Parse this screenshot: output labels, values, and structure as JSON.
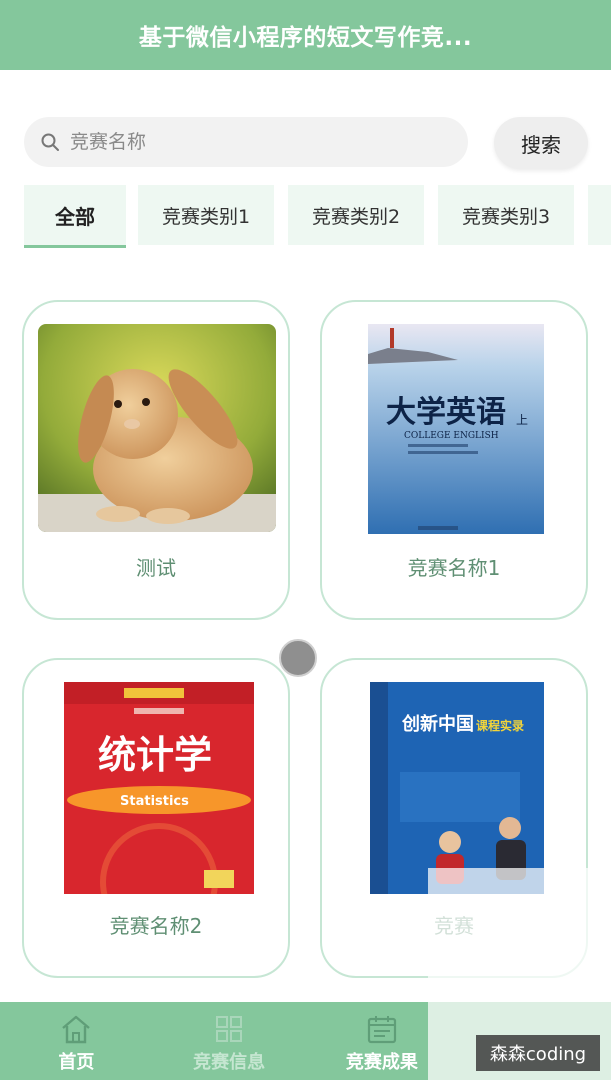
{
  "header": {
    "title": "基于微信小程序的短文写作竞..."
  },
  "search": {
    "placeholder": "竞赛名称",
    "button_label": "搜索"
  },
  "tabs": [
    {
      "label": "全部",
      "active": true
    },
    {
      "label": "竞赛类别1",
      "active": false
    },
    {
      "label": "竞赛类别2",
      "active": false
    },
    {
      "label": "竞赛类别3",
      "active": false
    }
  ],
  "cards": [
    {
      "name": "测试",
      "image": "rabbit-photo"
    },
    {
      "name": "竞赛名称1",
      "image": "book-cover-college-english",
      "cover_title": "大学英语",
      "cover_mark": "上",
      "cover_subtitle": "COLLEGE ENGLISH"
    },
    {
      "name": "竞赛名称2",
      "image": "book-cover-statistics",
      "cover_title": "统计学",
      "cover_subtitle": "Statistics"
    },
    {
      "name": "竞赛",
      "image": "book-cover-innovation-china",
      "cover_title": "创新中国",
      "cover_mark": "课程实录"
    }
  ],
  "bottom_nav": [
    {
      "label": "首页",
      "icon": "home-icon"
    },
    {
      "label": "竞赛信息",
      "icon": "grid-icon"
    },
    {
      "label": "竞赛成果",
      "icon": "calendar-icon"
    }
  ],
  "watermark": "森森coding",
  "colors": {
    "theme": "#84c79c",
    "card_border": "#c6e6d4",
    "tab_bg": "#eef8f2",
    "card_text": "#5f8f73"
  }
}
